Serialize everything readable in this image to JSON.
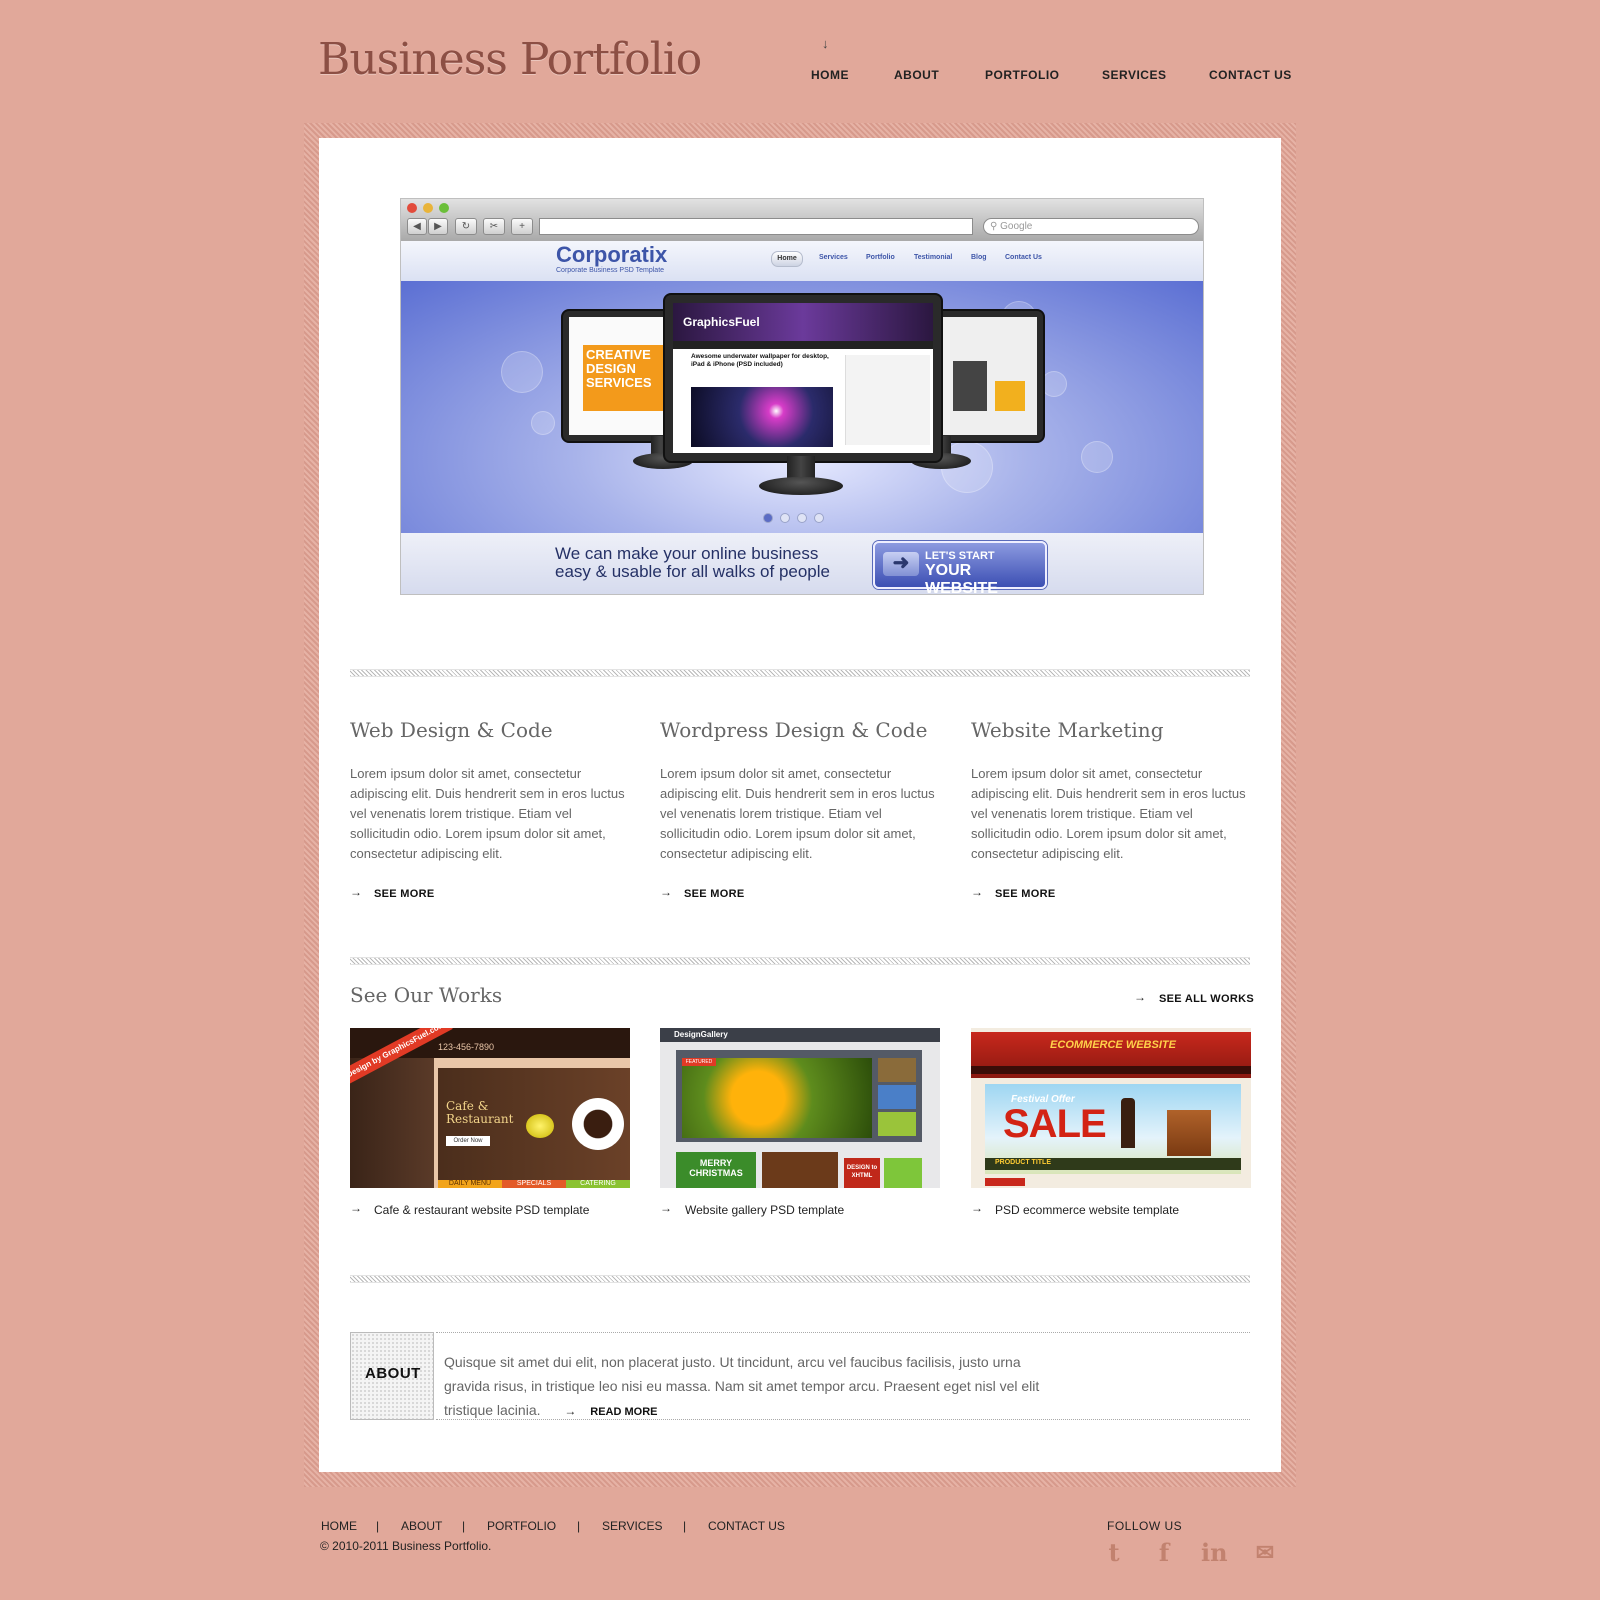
{
  "header": {
    "logo": "Business Portfolio",
    "nav_indicator": "↓",
    "nav": [
      "HOME",
      "ABOUT",
      "PORTFOLIO",
      "SERVICES",
      "CONTACT US"
    ]
  },
  "featured": {
    "browser_search_placeholder": "Google",
    "site": {
      "logo": "Corporatix",
      "tagline": "Corporate Business PSD Template",
      "nav": [
        "Home",
        "Services",
        "Portfolio",
        "Testimonial",
        "Blog",
        "Contact Us"
      ]
    },
    "slide": {
      "screen_brand": "GraphicsFuel",
      "screen_headline": "Awesome underwater wallpaper for desktop, iPad & iPhone (PSD included)",
      "left_screen_text": "CREATIVE DESIGN SERVICES",
      "slide_count": 4,
      "active_slide": 1
    },
    "cta": {
      "text_line1": "We can make your online business",
      "text_line2": "easy & usable for all walks of people",
      "button_line1": "LET'S START",
      "button_line2": "YOUR WEBSITE"
    }
  },
  "services": [
    {
      "title": "Web Design & Code",
      "text": "Lorem ipsum dolor sit amet, consectetur adipiscing elit. Duis hendrerit sem in eros luctus vel venenatis lorem tristique. Etiam vel sollicitudin odio. Lorem ipsum dolor sit amet, consectetur adipiscing elit.",
      "link": "SEE MORE"
    },
    {
      "title": "Wordpress Design & Code",
      "text": "Lorem ipsum dolor sit amet, consectetur adipiscing elit. Duis hendrerit sem in eros luctus vel venenatis lorem tristique. Etiam vel sollicitudin odio. Lorem ipsum dolor sit amet, consectetur adipiscing elit.",
      "link": "SEE MORE"
    },
    {
      "title": "Website Marketing",
      "text": "Lorem ipsum dolor sit amet, consectetur adipiscing elit. Duis hendrerit sem in eros luctus vel venenatis lorem tristique. Etiam vel sollicitudin odio. Lorem ipsum dolor sit amet, consectetur adipiscing elit.",
      "link": "SEE MORE"
    }
  ],
  "works": {
    "title": "See Our Works",
    "all_link": "SEE ALL WORKS",
    "items": [
      {
        "caption": "Cafe & restaurant website PSD template",
        "ribbon": "Design by GraphicsFuel.com",
        "phone": "123-456-7890",
        "heading": "Cafe & Restaurant",
        "button": "Order Now",
        "tabs": [
          "DAILY MENU",
          "SPECIALS",
          "CATERING"
        ]
      },
      {
        "caption": "Website gallery PSD template",
        "logo": "DesignGallery",
        "badge": "FEATURED",
        "tile_1": "MERRY CHRISTMAS",
        "tile_2": "DESIGN to XHTML"
      },
      {
        "caption": "PSD ecommerce website template",
        "heading": "ECOMMERCE WEBSITE",
        "offer": "Festival Offer",
        "sale": "SALE",
        "product": "PRODUCT TITLE"
      }
    ]
  },
  "about": {
    "label": "ABOUT",
    "text": "Quisque sit amet dui elit, non placerat justo. Ut tincidunt, arcu vel faucibus facilisis, justo urna gravida risus, in tristique leo nisi eu massa. Nam sit amet tempor arcu. Praesent eget nisl vel elit tristique lacinia.",
    "link": "READ MORE"
  },
  "footer": {
    "nav": [
      "HOME",
      "ABOUT",
      "PORTFOLIO",
      "SERVICES",
      "CONTACT US"
    ],
    "separator": "|",
    "copyright": "© 2010-2011 Business Portfolio.",
    "follow_label": "FOLLOW US",
    "social_icons": [
      "twitter-icon",
      "facebook-icon",
      "linkedin-icon",
      "email-icon"
    ]
  },
  "colors": {
    "background": "#e1a89a",
    "logo": "#8c4f44",
    "heading_gray": "#666666",
    "social_icon": "#c2826f"
  }
}
